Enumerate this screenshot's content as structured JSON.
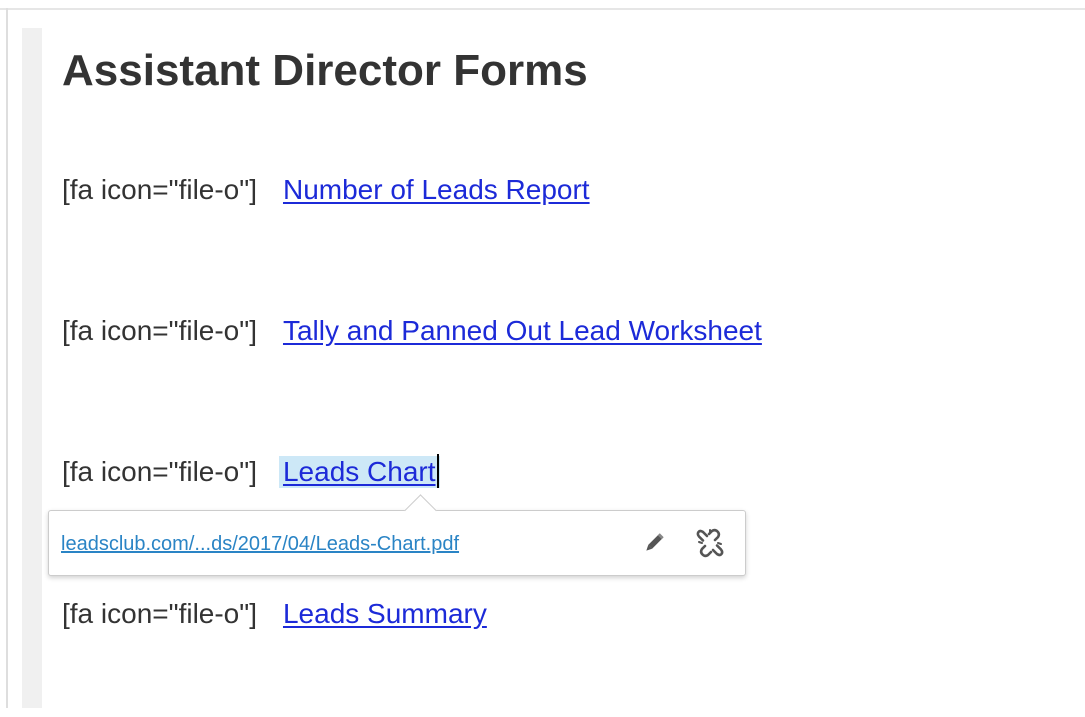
{
  "page": {
    "title": "Assistant Director Forms"
  },
  "items": [
    {
      "shortcode": "[fa icon=\"file-o\"]",
      "link_text": "Number of Leads Report"
    },
    {
      "shortcode": "[fa icon=\"file-o\"]",
      "link_text": "Tally and Panned Out Lead Worksheet"
    },
    {
      "shortcode": "[fa icon=\"file-o\"]",
      "link_text": "Leads Chart"
    },
    {
      "shortcode": "[fa icon=\"file-o\"]",
      "link_text": "Leads Summary"
    }
  ],
  "link_popup": {
    "url": "leadsclub.com/...ds/2017/04/Leads-Chart.pdf",
    "edit_icon": "pencil-icon",
    "unlink_icon": "unlink-icon"
  },
  "colors": {
    "link": "#1c2ad8",
    "selection": "#cde8f7",
    "popup_url": "#2a84c5",
    "text": "#333333"
  }
}
